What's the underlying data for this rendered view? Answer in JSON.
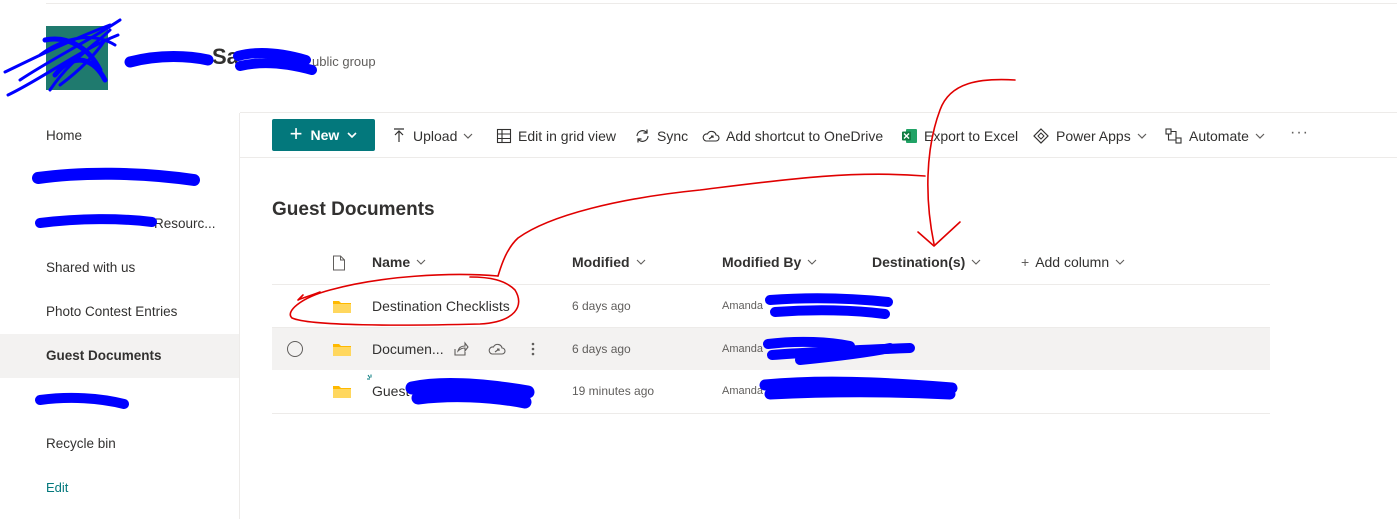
{
  "site": {
    "title": "Sa",
    "subtitle": "ublic group"
  },
  "nav": {
    "items": [
      {
        "label": "Home",
        "selected": false
      },
      {
        "label": "",
        "selected": false
      },
      {
        "label": "Resourc...",
        "selected": false
      },
      {
        "label": "Shared with us",
        "selected": false
      },
      {
        "label": "Photo Contest Entries",
        "selected": false
      },
      {
        "label": "Guest Documents",
        "selected": true
      },
      {
        "label": "",
        "selected": false
      },
      {
        "label": "Recycle bin",
        "selected": false
      }
    ],
    "edit_label": "Edit"
  },
  "toolbar": {
    "new_label": "New",
    "upload_label": "Upload",
    "grid_label": "Edit in grid view",
    "sync_label": "Sync",
    "shortcut_label": "Add shortcut to OneDrive",
    "excel_label": "Export to Excel",
    "powerapps_label": "Power Apps",
    "automate_label": "Automate",
    "more_label": "···"
  },
  "list": {
    "title": "Guest Documents",
    "columns": {
      "name": "Name",
      "modified": "Modified",
      "modified_by": "Modified By",
      "destinations": "Destination(s)",
      "add_column": "Add column"
    },
    "rows": [
      {
        "name": "Destination Checklists",
        "modified": "6 days ago",
        "modified_by": "Amanda"
      },
      {
        "name": "Documen...",
        "modified": "6 days ago",
        "modified_by": "Amanda"
      },
      {
        "name": "Guest",
        "modified": "19 minutes ago",
        "modified_by": "Amanda"
      }
    ]
  },
  "colors": {
    "accent": "#03787c",
    "folder": "#ffb900",
    "redaction": "#0000ff",
    "annotation": "#e00000"
  }
}
